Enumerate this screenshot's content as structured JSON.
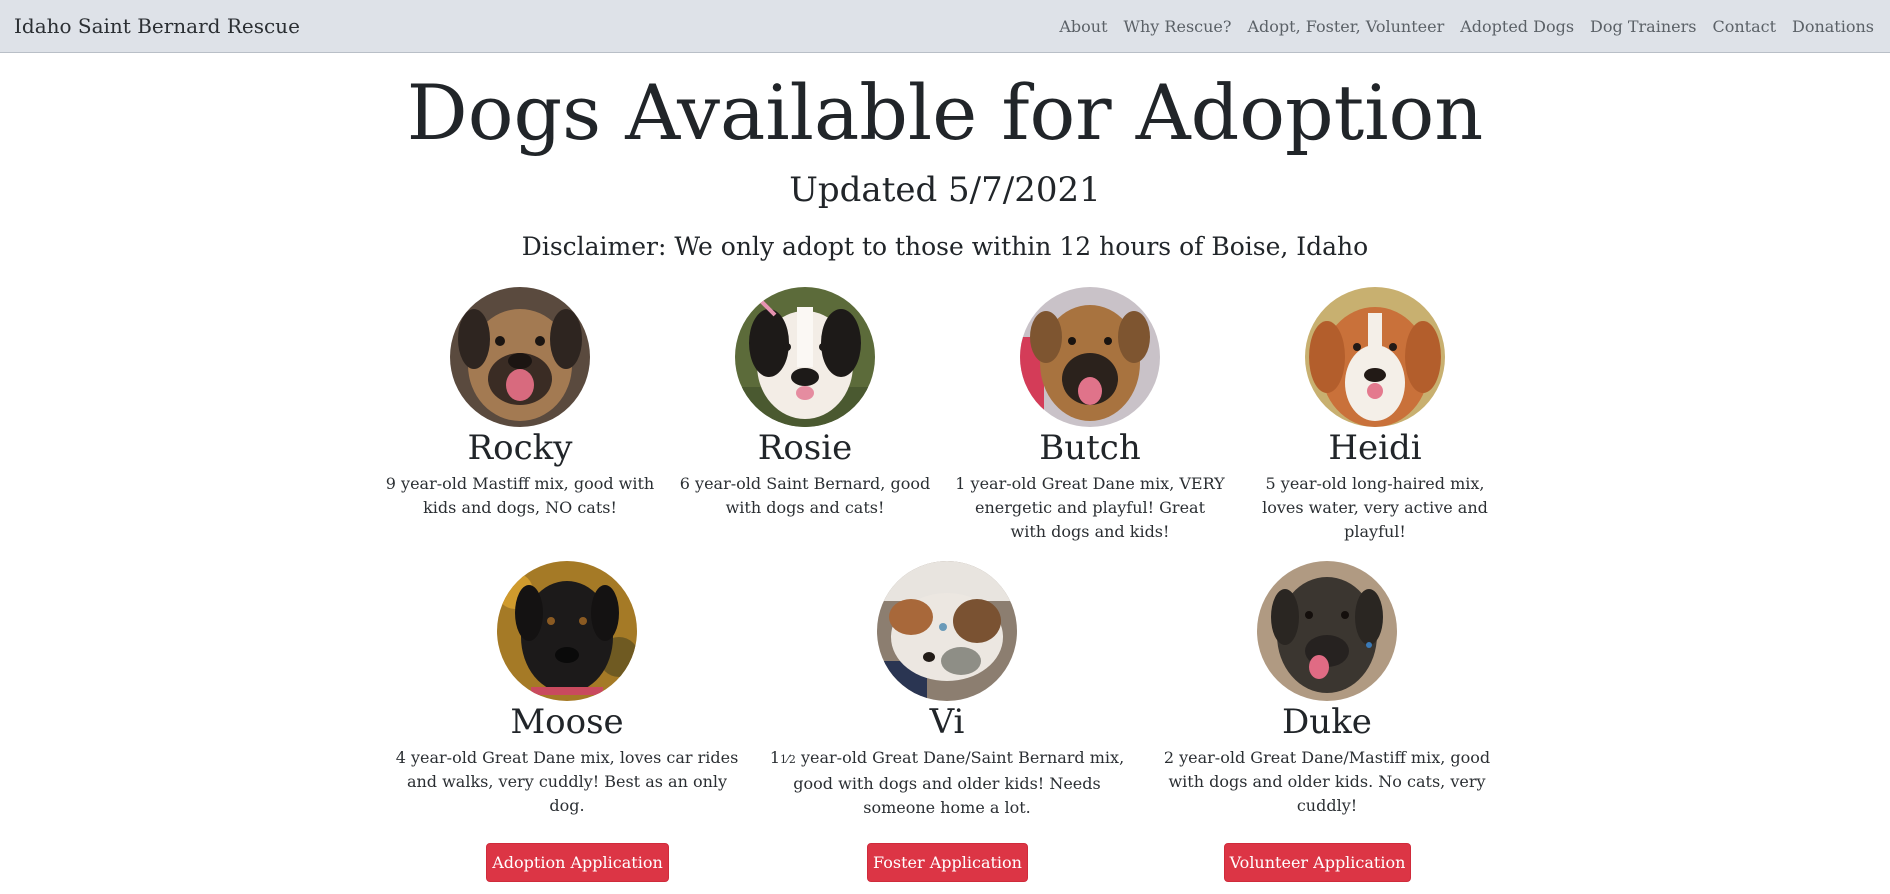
{
  "navbar": {
    "brand": "Idaho Saint Bernard Rescue",
    "links": [
      "About",
      "Why Rescue?",
      "Adopt, Foster, Volunteer",
      "Adopted Dogs",
      "Dog Trainers",
      "Contact",
      "Donations"
    ]
  },
  "page": {
    "title": "Dogs Available for Adoption",
    "updated": "Updated 5/7/2021",
    "disclaimer": "Disclaimer: We only adopt to those within 12 hours of Boise, Idaho"
  },
  "dogs": [
    {
      "name": "Rocky",
      "description": "9 year-old Mastiff mix, good with kids and dogs, NO cats!",
      "photo_icon": "rocky-photo"
    },
    {
      "name": "Rosie",
      "description": "6 year-old Saint Bernard, good with dogs and cats!",
      "photo_icon": "rosie-photo"
    },
    {
      "name": "Butch",
      "description": "1 year-old Great Dane mix, VERY energetic and playful! Great with dogs and kids!",
      "photo_icon": "butch-photo"
    },
    {
      "name": "Heidi",
      "description": "5 year-old long-haired mix, loves water, very active and playful!",
      "photo_icon": "heidi-photo"
    },
    {
      "name": "Moose",
      "description": "4 year-old Great Dane mix, loves car rides and walks, very cuddly! Best as an only dog.",
      "photo_icon": "moose-photo"
    },
    {
      "name": "Vi",
      "age_whole": "1",
      "age_frac": "1⁄2",
      "description": " year-old Great Dane/Saint Bernard mix, good with dogs and older kids! Needs someone home a lot.",
      "photo_icon": "vi-photo"
    },
    {
      "name": "Duke",
      "description": "2 year-old Great Dane/Mastiff mix, good with dogs and older kids. No cats, very cuddly!",
      "photo_icon": "duke-photo"
    }
  ],
  "buttons": {
    "adoption": "Adoption Application",
    "foster": "Foster Application",
    "volunteer": "Volunteer Application"
  },
  "colors": {
    "navbar_bg": "#dee2e8",
    "button_red": "#dc3545",
    "text": "#212529"
  }
}
